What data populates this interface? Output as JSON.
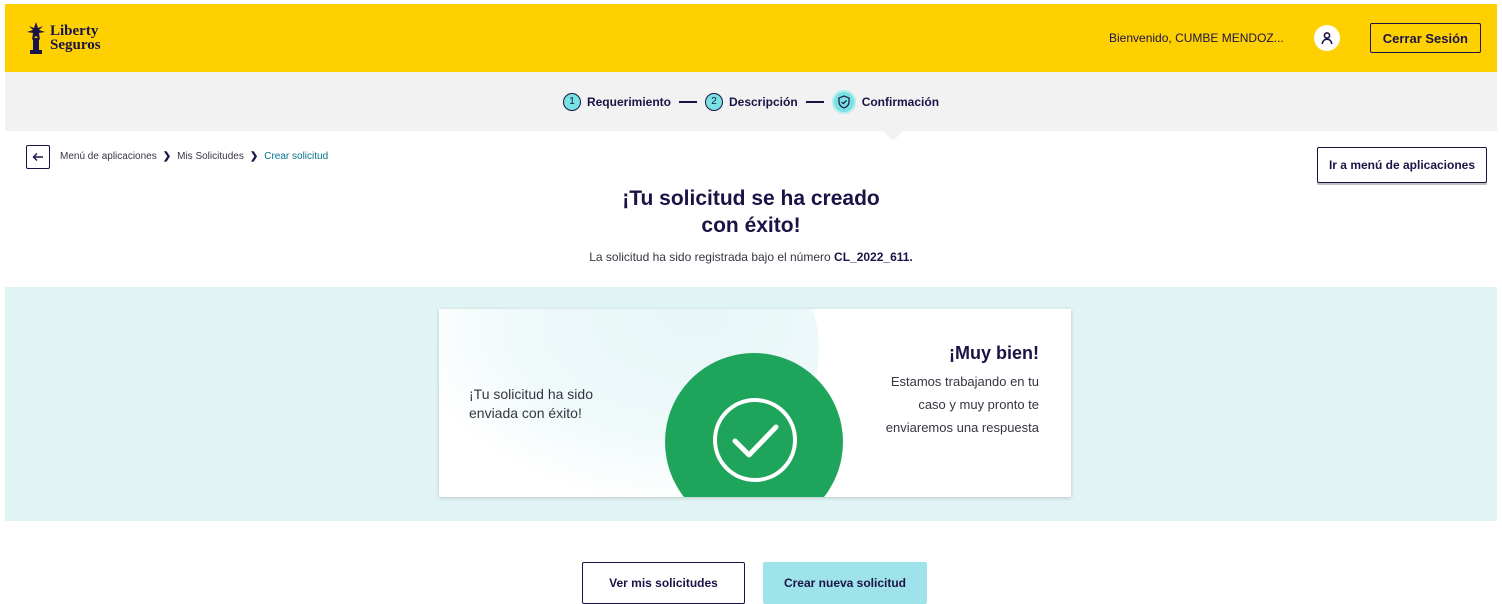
{
  "header": {
    "logo_line1": "Liberty",
    "logo_line2": "Seguros",
    "welcome": "Bienvenido, CUMBE MENDOZ...",
    "logout_label": "Cerrar Sesión"
  },
  "stepper": {
    "steps": [
      {
        "number": "1",
        "label": "Requerimiento"
      },
      {
        "number": "2",
        "label": "Descripción"
      },
      {
        "icon": "check-shield-icon",
        "label": "Confirmación"
      }
    ]
  },
  "breadcrumb": {
    "items": [
      "Menú de aplicaciones",
      "Mis Solicitudes",
      "Crear solicitud"
    ]
  },
  "apps_button_label": "Ir a menú de aplicaciones",
  "title_line1": "¡Tu solicitud se ha creado",
  "title_line2": "con éxito!",
  "subtitle_prefix": "La solicitud ha sido registrada bajo el número ",
  "request_number": "CL_2022_611.",
  "card": {
    "left_line1": "¡Tu solicitud ha sido",
    "left_line2": "enviada con éxito!",
    "headline": "¡Muy bien!",
    "msg_line1": "Estamos trabajando en tu",
    "msg_line2": "caso y muy pronto te",
    "msg_line3": "enviaremos una respuesta"
  },
  "buttons": {
    "view_label": "Ver mis solicitudes",
    "create_label": "Crear nueva solicitud"
  },
  "colors": {
    "brand_yellow": "#ffd000",
    "navy": "#1a1446",
    "teal": "#78e1e1",
    "success_green": "#1fa55b"
  }
}
